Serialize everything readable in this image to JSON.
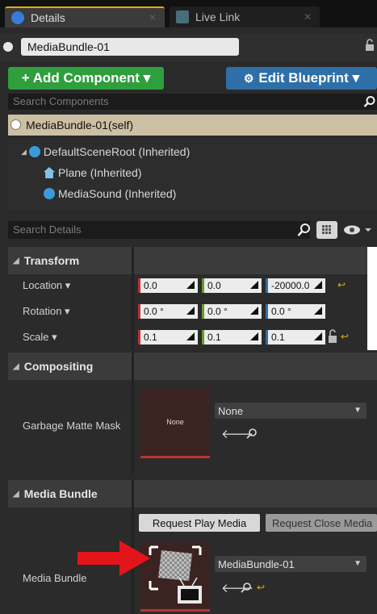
{
  "tabs": [
    {
      "label": "Details",
      "active": true
    },
    {
      "label": "Live Link",
      "active": false
    }
  ],
  "actor": {
    "name": "MediaBundle-01"
  },
  "buttons": {
    "add_component": "+ Add Component",
    "add_component_chevron": "▾",
    "edit_blueprint": "Edit Blueprint",
    "edit_blueprint_chevron": "▾"
  },
  "search": {
    "components_placeholder": "Search Components",
    "details_placeholder": "Search Details"
  },
  "self_row": {
    "label": "MediaBundle-01(self)"
  },
  "tree": [
    {
      "label": "DefaultSceneRoot (Inherited)"
    },
    {
      "label": "Plane (Inherited)"
    },
    {
      "label": "MediaSound (Inherited)"
    }
  ],
  "sections": {
    "transform": {
      "title": "Transform",
      "location": {
        "label": "Location ▾",
        "x": "0.0",
        "y": "0.0",
        "z": "-20000.0"
      },
      "rotation": {
        "label": "Rotation ▾",
        "x": "0.0 °",
        "y": "0.0 °",
        "z": "0.0 °"
      },
      "scale": {
        "label": "Scale ▾",
        "x": "0.1",
        "y": "0.1",
        "z": "0.1"
      }
    },
    "compositing": {
      "title": "Compositing",
      "garbage_matte_label": "Garbage Matte Mask",
      "thumb_text": "None",
      "dropdown_value": "None"
    },
    "media_bundle": {
      "title": "Media Bundle",
      "request_play": "Request Play Media",
      "request_close": "Request Close Media",
      "field_label": "Media Bundle",
      "dropdown_value": "MediaBundle-01"
    }
  },
  "colors": {
    "accent_tab": "#e0b000",
    "add_green": "#2f9e3c",
    "blueprint_blue": "#2f6fa8",
    "x_red": "#b33333",
    "y_green": "#6a9b2a",
    "z_blue": "#2f6fa8",
    "arrow_red": "#e3151a"
  }
}
